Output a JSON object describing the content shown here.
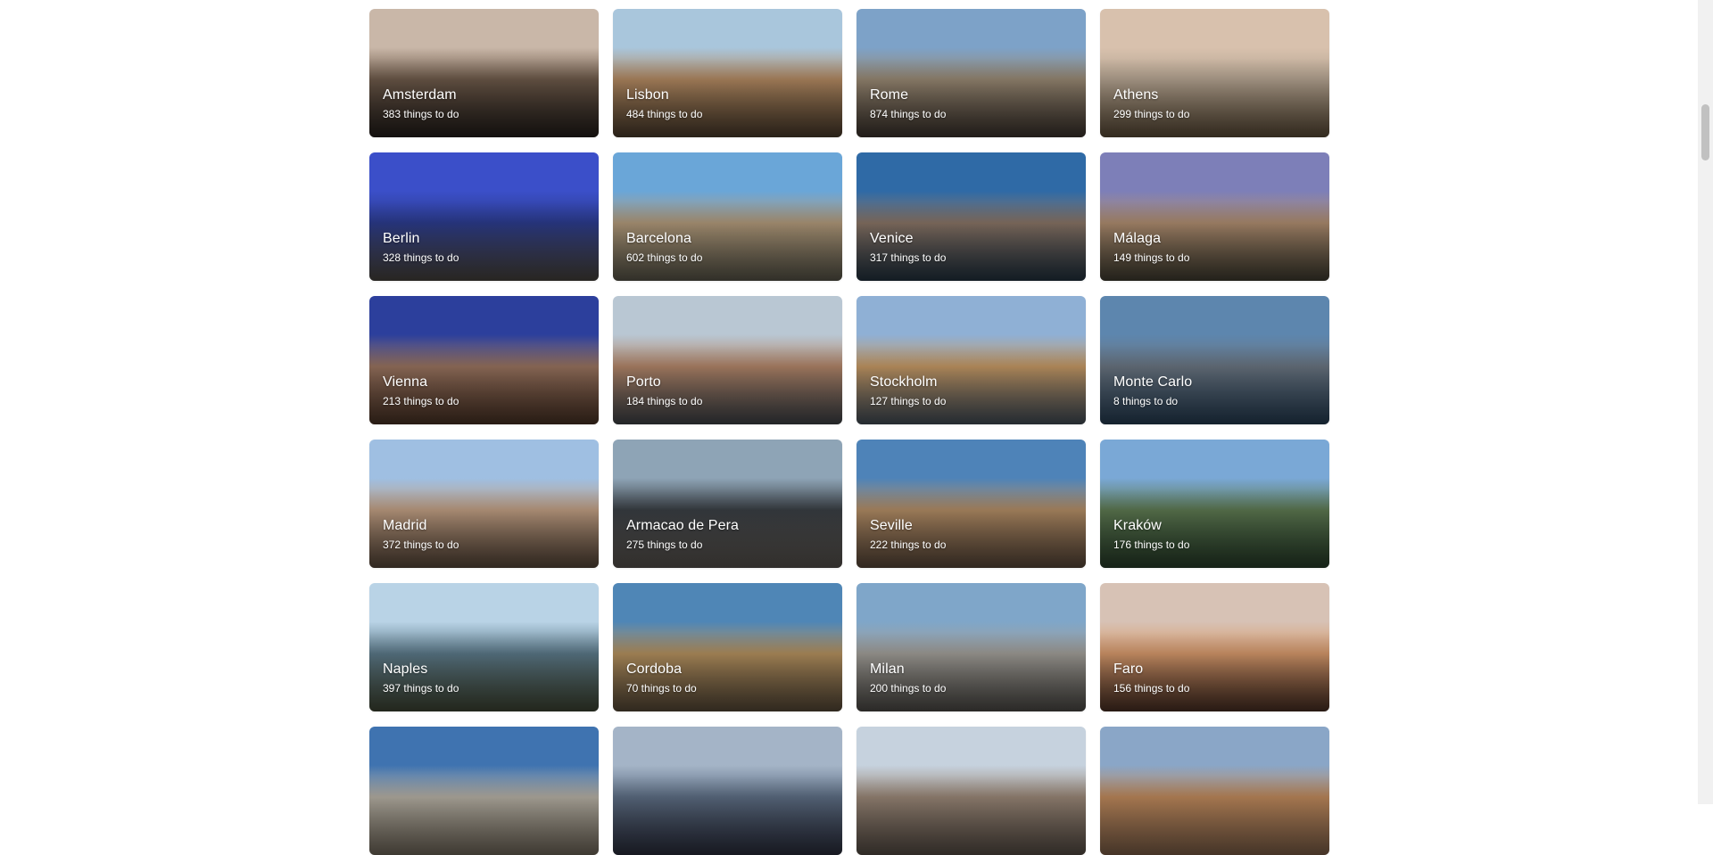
{
  "destinations": [
    {
      "city": "Amsterdam",
      "count": "383 things to do",
      "sky": "#c9b7a8",
      "mid": "#6e5a4a",
      "ground": "#2b2420"
    },
    {
      "city": "Lisbon",
      "count": "484 things to do",
      "sky": "#a9c6dc",
      "mid": "#b48a62",
      "ground": "#5c4a36"
    },
    {
      "city": "Rome",
      "count": "874 things to do",
      "sky": "#7da2c8",
      "mid": "#9a8a74",
      "ground": "#4a4038"
    },
    {
      "city": "Athens",
      "count": "299 things to do",
      "sky": "#d8c1ad",
      "mid": "#b7a693",
      "ground": "#6f5d44"
    },
    {
      "city": "Berlin",
      "count": "328 things to do",
      "sky": "#3b4fc9",
      "mid": "#2c3c8e",
      "ground": "#58534c"
    },
    {
      "city": "Barcelona",
      "count": "602 things to do",
      "sky": "#6aa6d8",
      "mid": "#b39b7b",
      "ground": "#6d6a5a"
    },
    {
      "city": "Venice",
      "count": "317 things to do",
      "sky": "#2f6aa6",
      "mid": "#8a7566",
      "ground": "#2b3e4e"
    },
    {
      "city": "Málaga",
      "count": "149 things to do",
      "sky": "#7d7fb8",
      "mid": "#b08e70",
      "ground": "#4f4b3c"
    },
    {
      "city": "Vienna",
      "count": "213 things to do",
      "sky": "#2c3f9c",
      "mid": "#9b7560",
      "ground": "#5a3e2e"
    },
    {
      "city": "Porto",
      "count": "184 things to do",
      "sky": "#b9c7d3",
      "mid": "#b4876a",
      "ground": "#4f5358"
    },
    {
      "city": "Stockholm",
      "count": "127 things to do",
      "sky": "#8fb0d5",
      "mid": "#c79a65",
      "ground": "#53606c"
    },
    {
      "city": "Monte Carlo",
      "count": "8 things to do",
      "sky": "#5d86ae",
      "mid": "#6b7682",
      "ground": "#2e4b66"
    },
    {
      "city": "Madrid",
      "count": "372 things to do",
      "sky": "#9fbfe2",
      "mid": "#c2a084",
      "ground": "#6a5646"
    },
    {
      "city": "Armacao de Pera",
      "count": "275 things to do",
      "sky": "#8ea4b6",
      "mid": "#3a3f44",
      "ground": "#6c6660"
    },
    {
      "city": "Seville",
      "count": "222 things to do",
      "sky": "#4e83b8",
      "mid": "#b48e66",
      "ground": "#6d5746"
    },
    {
      "city": "Kraków",
      "count": "176 things to do",
      "sky": "#7aa8d6",
      "mid": "#5e7a52",
      "ground": "#2f4a32"
    },
    {
      "city": "Naples",
      "count": "397 things to do",
      "sky": "#b9d3e6",
      "mid": "#5c7a8a",
      "ground": "#4d5540"
    },
    {
      "city": "Cordoba",
      "count": "70 things to do",
      "sky": "#4f86b6",
      "mid": "#b6925f",
      "ground": "#6b5a44"
    },
    {
      "city": "Milan",
      "count": "200 things to do",
      "sky": "#7fa6c9",
      "mid": "#a3a09a",
      "ground": "#5e5b56"
    },
    {
      "city": "Faro",
      "count": "156 things to do",
      "sky": "#d7c2b5",
      "mid": "#d89a6c",
      "ground": "#5a3a2c"
    },
    {
      "city": "",
      "count": "",
      "sky": "#3f73b0",
      "mid": "#b8b2a6",
      "ground": "#8a8070"
    },
    {
      "city": "",
      "count": "",
      "sky": "#a4b4c7",
      "mid": "#5e6f85",
      "ground": "#34384a"
    },
    {
      "city": "",
      "count": "",
      "sky": "#c6d2de",
      "mid": "#9b8878",
      "ground": "#6a5f55"
    },
    {
      "city": "",
      "count": "",
      "sky": "#8aa6c7",
      "mid": "#c08a5c",
      "ground": "#9a7558"
    }
  ]
}
